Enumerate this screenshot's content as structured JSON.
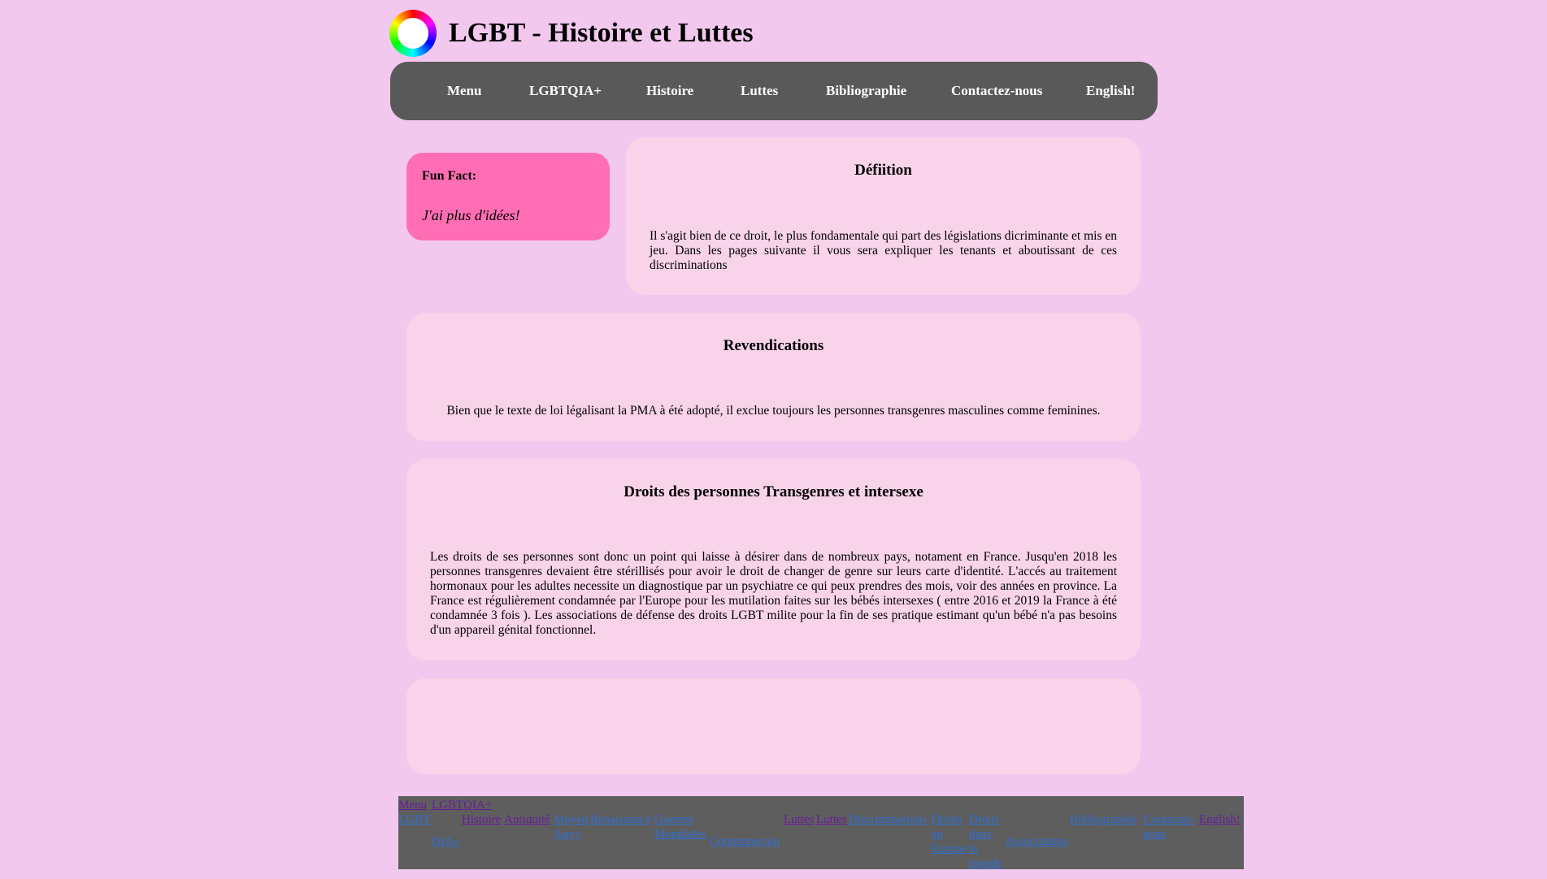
{
  "site_title": "LGBT - Histoire et Luttes",
  "nav": [
    "Menu",
    "LGBTQIA+",
    "Histoire",
    "Luttes",
    "Bibliographie",
    "Contactez-nous",
    "English!"
  ],
  "funfact": {
    "label": "Fun Fact:",
    "text": "J'ai plus d'idées!"
  },
  "definition": {
    "title": "Défiition",
    "text": "Il s'agit bien de ce droit, le plus fondamentale qui part des législations dicriminante et mis en jeu. Dans les pages suivante il vous sera expliquer les tenants et aboutissant de ces discriminations"
  },
  "revendications": {
    "title": "Revendications",
    "text": "Bien que le texte de loi légalisant la PMA à été adopté, il exclue toujours les personnes transgenres masculines comme feminines."
  },
  "droits": {
    "title": "Droits des personnes Transgenres et intersexe",
    "text": "Les droits de ses personnes sont donc un point qui laisse à désirer dans de nombreux pays, notament en France. Jusqu'en 2018 les personnes transgenres devaient être stérillisés pour avoir le droit de changer de genre sur leurs carte d'identité. L'accés au traitement hormonaux pour les adultes necessite un diagnostique par un psychiatre ce qui peux prendres des mois, voir des années en province. La France est régulièrement condamnée par l'Europe pour les mutilation faites sur les bébés intersexes ( entre 2016 et 2019 la France à été condamnée 3 fois ). Les associations de défense des droits LGBT milite pour la fin de ses pratique estimant qu'un bébé n'a pas besoins d'un appareil génital fonctionnel."
  },
  "footer": {
    "menu": "Menu",
    "lgbt": "LGBT",
    "lgbtqia_top": "LGBTQIA+",
    "qia": "QIA+",
    "histoire": "Histoire",
    "antiquite": "Antiquité",
    "moyen": "Moyen",
    "age": "Age+",
    "renaissance": "Renaissance",
    "guerres": "Guerres",
    "mondiales": "Mondiales",
    "contemporain": "Contemporain",
    "luttes1": "Luttes",
    "luttes2": "Luttes",
    "discriminations": "Discriminations",
    "droits_en_europe": [
      "Droits",
      "en",
      "Europe"
    ],
    "droits_dans_le_monde": [
      "Droits",
      "dans",
      "le",
      "monde"
    ],
    "associations": "Associations",
    "bibliographie": "Bibliographie",
    "contactez": [
      "Contactez-",
      "nous"
    ],
    "english": "English!"
  }
}
